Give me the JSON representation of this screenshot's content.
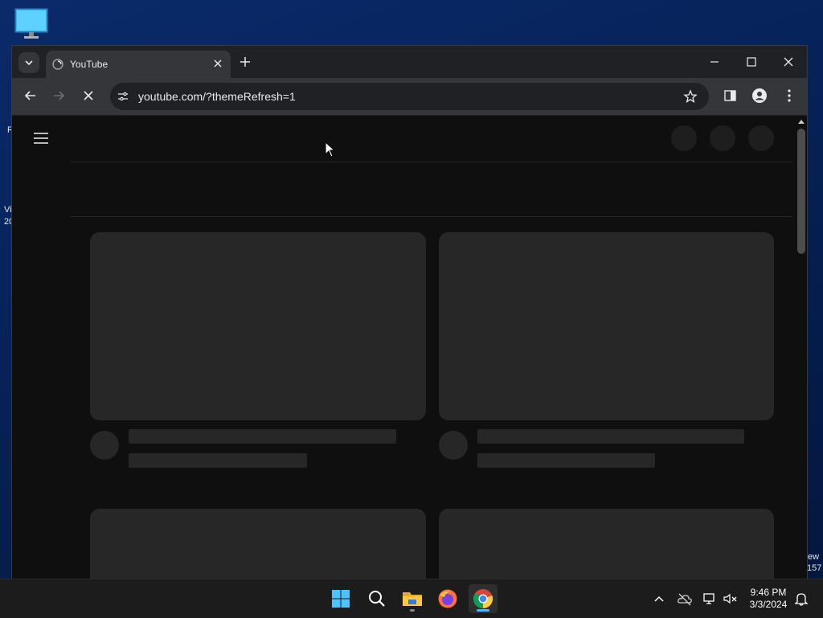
{
  "desktop": {
    "fragments": [
      "R",
      "Vi",
      "20",
      "ew",
      "157"
    ]
  },
  "browser": {
    "tab": {
      "title": "YouTube"
    },
    "address": {
      "url": "youtube.com/?themeRefresh=1"
    }
  },
  "taskbar": {
    "clock": {
      "time": "9:46 PM",
      "date": "3/3/2024"
    }
  },
  "colors": {
    "page_bg": "#0f0f0f",
    "skeleton": "#272727",
    "chrome_frame": "#202124",
    "chrome_toolbar": "#35363a",
    "taskbar": "#1c1c1c",
    "accent": "#5ab3ff"
  },
  "icons": [
    "monitor-icon",
    "tab-search-icon",
    "youtube-favicon",
    "close-icon",
    "plus-icon",
    "minimize-icon",
    "maximize-icon",
    "back-icon",
    "forward-icon",
    "stop-icon",
    "site-info-icon",
    "star-icon",
    "side-panel-icon",
    "profile-icon",
    "menu-icon",
    "hamburger-icon",
    "windows-start-icon",
    "search-icon",
    "file-explorer-icon",
    "firefox-icon",
    "chrome-icon",
    "chevron-up-icon",
    "onedrive-icon",
    "network-icon",
    "volume-muted-icon",
    "bell-icon"
  ]
}
